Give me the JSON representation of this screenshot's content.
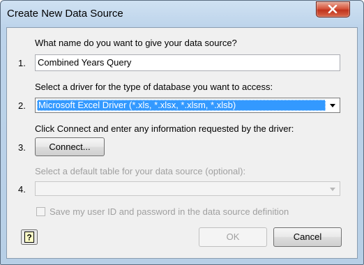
{
  "window": {
    "title": "Create New Data Source"
  },
  "step1": {
    "number": "1.",
    "prompt": "What name do you want to give your data source?",
    "value": "Combined Years Query"
  },
  "step2": {
    "number": "2.",
    "prompt": "Select a driver for the type of database you want to access:",
    "selected": "Microsoft Excel Driver (*.xls, *.xlsx, *.xlsm, *.xlsb)"
  },
  "step3": {
    "number": "3.",
    "prompt": "Click Connect and enter any information requested by the driver:",
    "button": "Connect..."
  },
  "step4": {
    "number": "4.",
    "prompt": "Select a default table for your data source (optional):",
    "value": ""
  },
  "save_checkbox": {
    "label": "Save my user ID and password in the data source definition",
    "checked": false
  },
  "buttons": {
    "ok": "OK",
    "cancel": "Cancel"
  },
  "colors": {
    "selection": "#3399ff",
    "close_button": "#c83b24",
    "frame": "#bcd3ea"
  }
}
